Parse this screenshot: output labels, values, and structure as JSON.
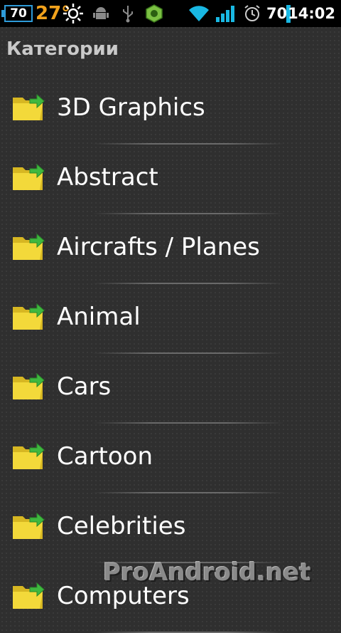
{
  "status_bar": {
    "battery_level_box": "70",
    "temperature": "27°",
    "battery_percent": "70",
    "time": "14:02",
    "icons": [
      "battery-icon",
      "weather-sun-icon",
      "android-debug-icon",
      "usb-icon",
      "app-notification-icon",
      "wifi-icon",
      "signal-icon",
      "alarm-icon"
    ]
  },
  "header": {
    "title": "Категории"
  },
  "categories": [
    {
      "label": "3D Graphics"
    },
    {
      "label": "Abstract"
    },
    {
      "label": "Aircrafts / Planes"
    },
    {
      "label": "Animal"
    },
    {
      "label": "Cars"
    },
    {
      "label": "Cartoon"
    },
    {
      "label": "Celebrities"
    },
    {
      "label": "Computers"
    }
  ],
  "watermark": "ProAndroid.net",
  "colors": {
    "background": "#2f2f2f",
    "folder": "#f3d93a",
    "arrow": "#3fb83f",
    "battery_accent": "#2e9bd9",
    "temperature": "#f2a21c",
    "wifi": "#19b8e3"
  }
}
